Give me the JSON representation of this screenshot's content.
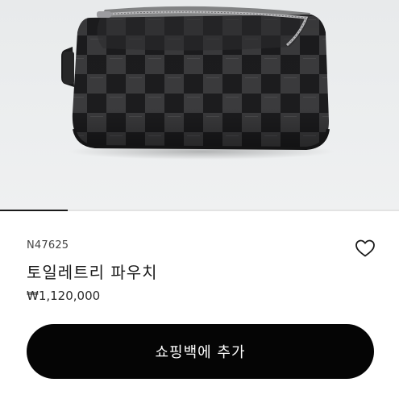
{
  "gallery": {
    "image_icon": "toiletry-pouch-image",
    "progress_fraction": 0.17
  },
  "product": {
    "sku": "N47625",
    "name": "토일레트리 파우치",
    "price": "₩1,120,000"
  },
  "actions": {
    "wishlist_icon": "heart-outline-icon",
    "add_to_cart_label": "쇼핑백에 추가"
  },
  "colors": {
    "button_background": "#050505",
    "button_text": "#ffffff",
    "hero_background": "#eceeef"
  }
}
